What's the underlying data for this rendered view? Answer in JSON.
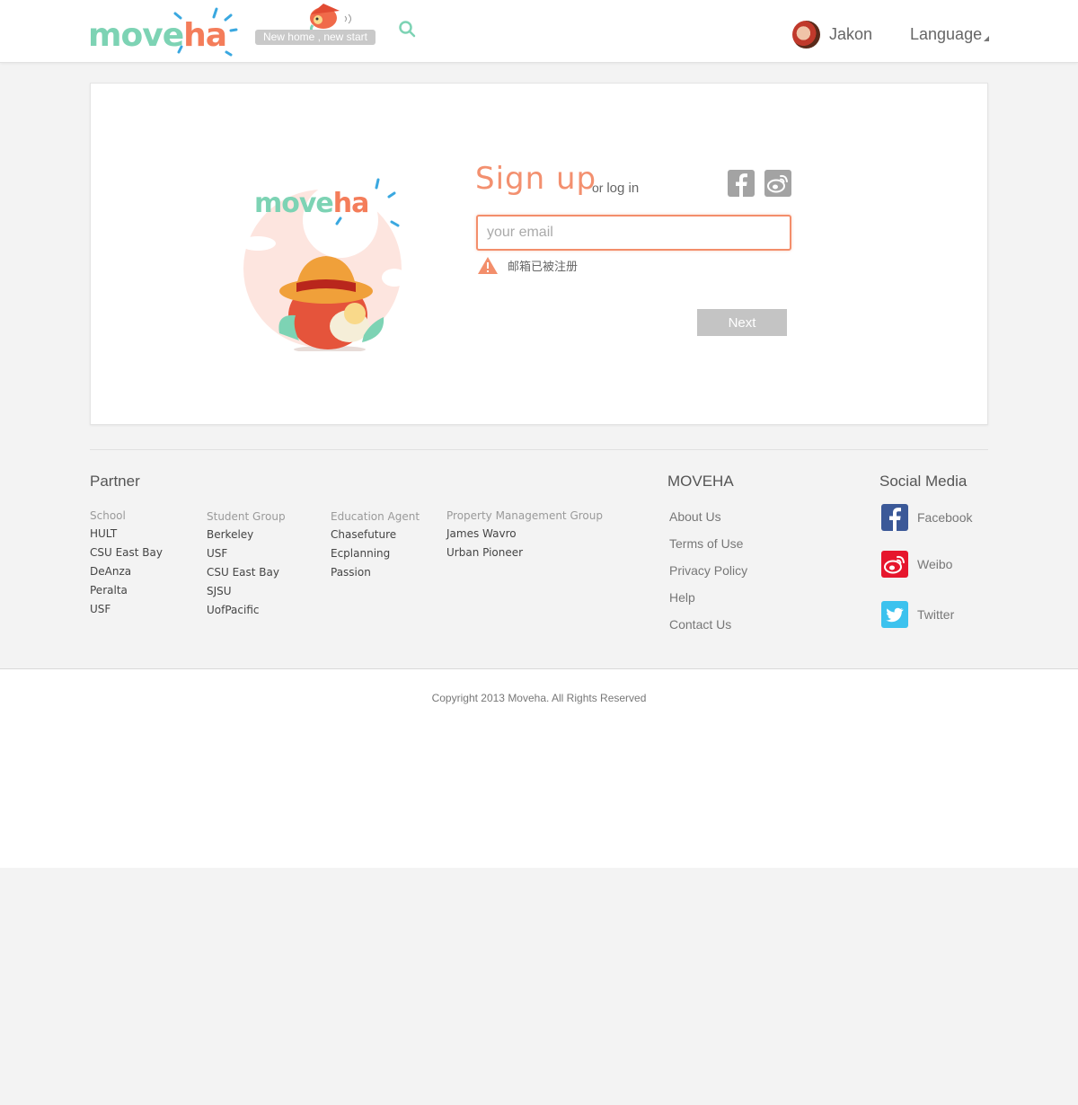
{
  "header": {
    "logo": {
      "left": "move",
      "right": "ha"
    },
    "tagline": "New home , new start",
    "user_name": "Jakon",
    "language_label": "Language"
  },
  "signup": {
    "title": "Sign up",
    "or_prefix": "or",
    "login_label": "log in",
    "email_placeholder": "your email",
    "error_message": "邮箱已被注册",
    "next_label": "Next"
  },
  "hero": {
    "logo": {
      "left": "move",
      "right": "ha"
    }
  },
  "footer": {
    "partner_title": "Partner",
    "groups": [
      {
        "heading": "School",
        "items": [
          "HULT",
          "CSU East Bay",
          "DeAnza",
          "Peralta",
          "USF"
        ]
      },
      {
        "heading": "Student Group",
        "items": [
          "Berkeley",
          "USF",
          "CSU East Bay",
          "SJSU",
          "UofPacific"
        ]
      },
      {
        "heading": "Education Agent",
        "items": [
          "Chasefuture",
          "Ecplanning",
          "Passion"
        ]
      },
      {
        "heading": "Property Management Group",
        "items": [
          "James Wavro",
          "Urban Pioneer"
        ]
      }
    ],
    "moveha_title": "MOVEHA",
    "moveha_links": [
      "About Us",
      "Terms of Use",
      "Privacy Policy",
      "Help",
      "Contact Us"
    ],
    "social_title": "Social Media",
    "social": [
      {
        "label": "Facebook",
        "icon": "facebook-icon",
        "color": "#3b5998"
      },
      {
        "label": "Weibo",
        "icon": "weibo-icon",
        "color": "#e6162d"
      },
      {
        "label": "Twitter",
        "icon": "twitter-icon",
        "color": "#3cc2ee"
      }
    ],
    "copyright": "Copyright 2013 Moveha.  All Rights Reserved"
  },
  "colors": {
    "accent": "#f3906f",
    "mint": "#7dd3b4",
    "icon_gray": "#a3a3a3"
  }
}
